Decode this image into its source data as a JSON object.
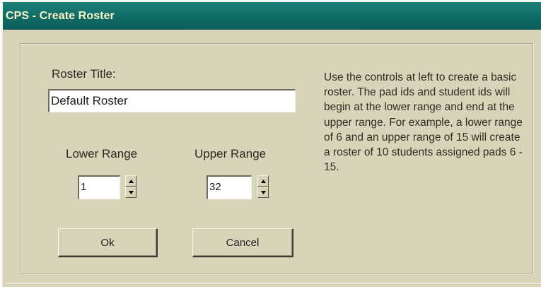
{
  "window": {
    "title": "CPS - Create Roster"
  },
  "form": {
    "roster_title_label": "Roster Title:",
    "roster_title_value": "Default Roster",
    "lower_range_label": "Lower Range",
    "lower_range_value": "1",
    "upper_range_label": "Upper Range",
    "upper_range_value": "32"
  },
  "buttons": {
    "ok_label": "Ok",
    "cancel_label": "Cancel"
  },
  "help": {
    "text": "Use the controls at left to create a basic roster. The pad ids and student ids will begin at the lower range and end at the upper range. For example, a lower range of 6 and an upper range of 15 will create a roster of 10 students assigned pads 6 - 15."
  },
  "icons": {
    "spin_up": "spin-up-arrow",
    "spin_down": "spin-down-arrow"
  },
  "colors": {
    "titlebar": "#0f6b66",
    "title_text": "#fbf6c8",
    "face": "#d8d4ba"
  }
}
